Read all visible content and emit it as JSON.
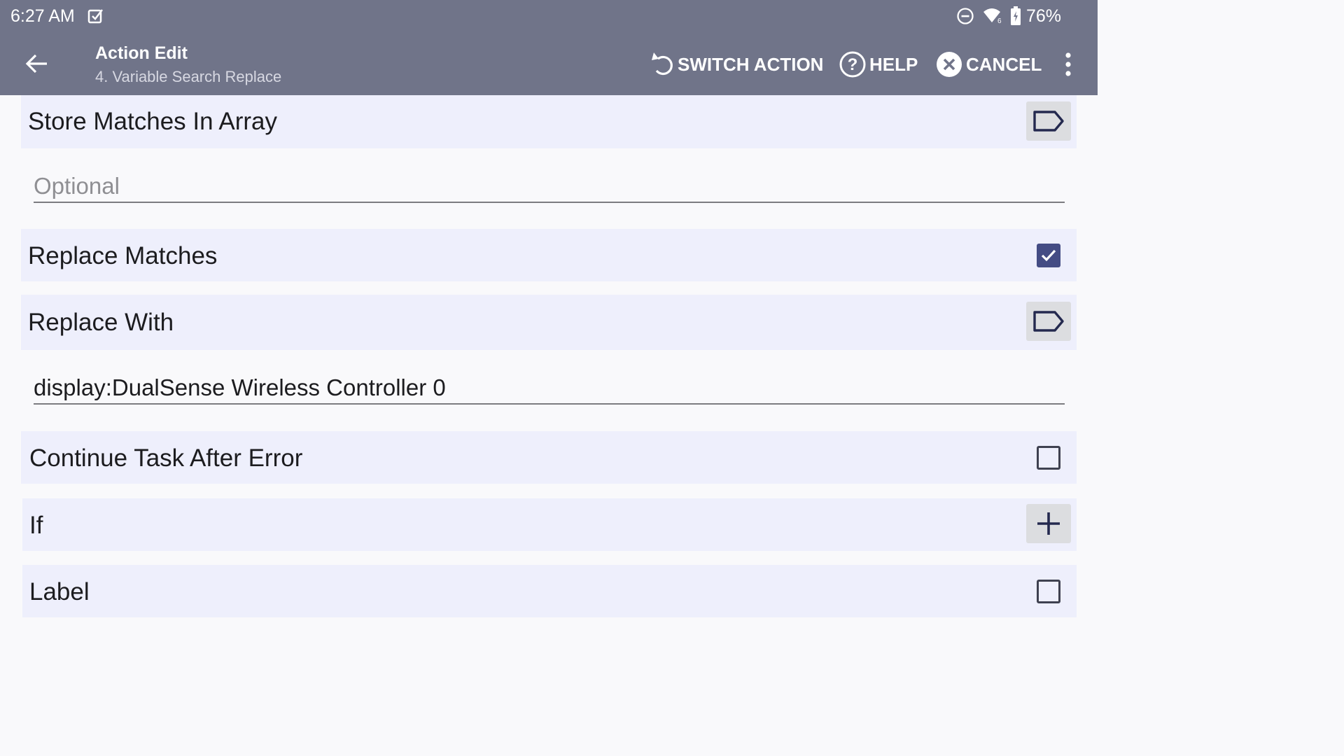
{
  "status_bar": {
    "time": "6:27 AM",
    "notification_icon": "checkbox-notification-icon",
    "dnd_icon": "do-not-disturb-icon",
    "wifi_icon": "wifi-icon",
    "battery_icon": "battery-charging-icon",
    "battery_percent": "76%"
  },
  "app_bar": {
    "title": "Action Edit",
    "subtitle": "4. Variable Search Replace",
    "switch_action_label": "SWITCH ACTION",
    "help_label": "HELP",
    "cancel_label": "CANCEL"
  },
  "form": {
    "store_matches": {
      "label": "Store Matches In Array"
    },
    "store_matches_input": {
      "placeholder": "Optional",
      "value": ""
    },
    "replace_matches": {
      "label": "Replace Matches",
      "checked": true
    },
    "replace_with": {
      "label": "Replace With"
    },
    "replace_with_input": {
      "value": "display:DualSense Wireless Controller 0"
    },
    "continue_after_error": {
      "label": "Continue Task After Error",
      "checked": false
    },
    "if_row": {
      "label": "If"
    },
    "label_row": {
      "label": "Label",
      "checked": false
    }
  },
  "colors": {
    "app_bar": "#707489",
    "row_background": "#eeeffc",
    "checkbox_checked": "#444c84",
    "icon_dark": "#24294f"
  }
}
